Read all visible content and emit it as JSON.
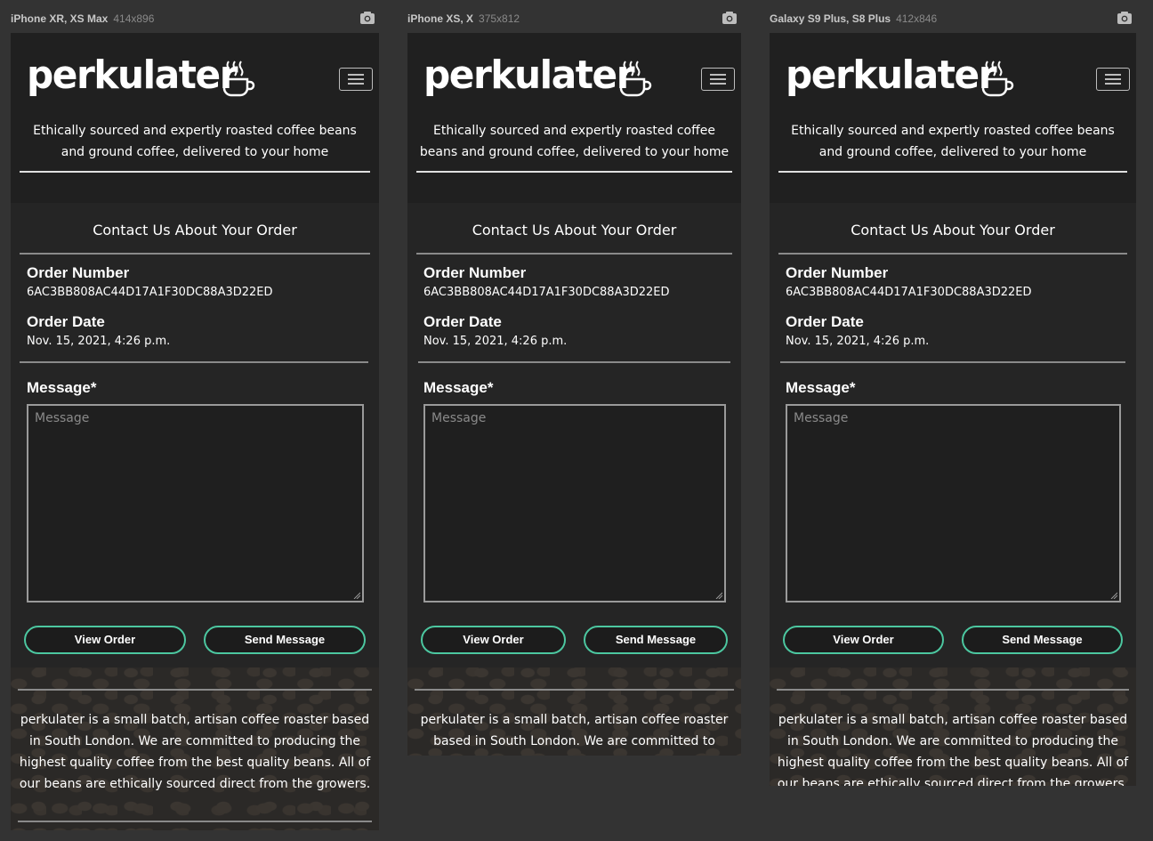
{
  "devices": [
    {
      "name": "iPhone XR, XS Max",
      "size": "414x896"
    },
    {
      "name": "iPhone XS, X",
      "size": "375x812"
    },
    {
      "name": "Galaxy S9 Plus, S8 Plus",
      "size": "412x846"
    }
  ],
  "icons": {
    "screenshot": "camera-icon",
    "menu": "hamburger-menu-icon",
    "logo_mark": "steaming-coffee-cup-icon"
  },
  "colors": {
    "accent": "#4cc7a0",
    "background": "#333333",
    "panel": "#252525"
  },
  "site": {
    "logo": "perkulater",
    "tagline_a": "Ethically sourced and expertly roasted coffee beans and ground coffee, delivered to your home",
    "tagline_b": "Ethically sourced and expertly roasted coffee beans and ground coffee, delivered to your home",
    "tagline_c": "Ethically sourced and expertly roasted coffee beans and ground coffee, delivered to your home"
  },
  "contact": {
    "title": "Contact Us About Your Order",
    "order_number_label": "Order Number",
    "order_number": "6AC3BB808AC44D17A1F30DC88A3D22ED",
    "order_date_label": "Order Date",
    "order_date": "Nov. 15, 2021, 4:26 p.m.",
    "message_label": "Message*",
    "message_placeholder": "Message",
    "view_order": "View Order",
    "send_message": "Send Message"
  },
  "footer": {
    "about": "perkulater is a small batch, artisan coffee roaster based in South London. We are committed to producing the highest quality coffee from the best quality beans. All of our beans are ethically sourced direct from the growers.",
    "about_b": "perkulater is a small batch, artisan coffee roaster based in South London. We are committed to",
    "about_c": "perkulater is a small batch, artisan coffee roaster based in South London. We are committed to producing the highest quality coffee from the best quality beans. All of our beans are ethically sourced direct from the growers."
  }
}
